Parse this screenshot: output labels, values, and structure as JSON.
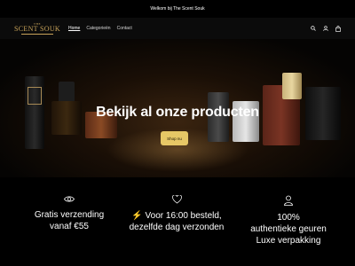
{
  "announcement": {
    "text": "Welkom bij The Scent Souk"
  },
  "header": {
    "logo_top": "THE",
    "logo_main": "SCENT SOUK",
    "nav": [
      {
        "label": "Home",
        "active": true
      },
      {
        "label": "Categorieën",
        "active": false
      },
      {
        "label": "Contact",
        "active": false
      }
    ],
    "icons": [
      "search-icon",
      "account-icon",
      "cart-icon"
    ]
  },
  "hero": {
    "title": "Bekijk al onze producten",
    "button_label": "Shop nu"
  },
  "features": [
    {
      "icon": "eye-icon",
      "lines": [
        "Gratis verzending",
        "vanaf €55"
      ]
    },
    {
      "icon": "heart-icon",
      "lines": [
        "⚡ Voor 16:00 besteld,",
        "dezelfde dag verzonden"
      ]
    },
    {
      "icon": "user-icon",
      "lines": [
        "100%",
        "authentieke geuren",
        "Luxe verpakking"
      ]
    }
  ],
  "colors": {
    "gold": "#c9a45a",
    "button": "#e6c766",
    "background": "#000000"
  }
}
